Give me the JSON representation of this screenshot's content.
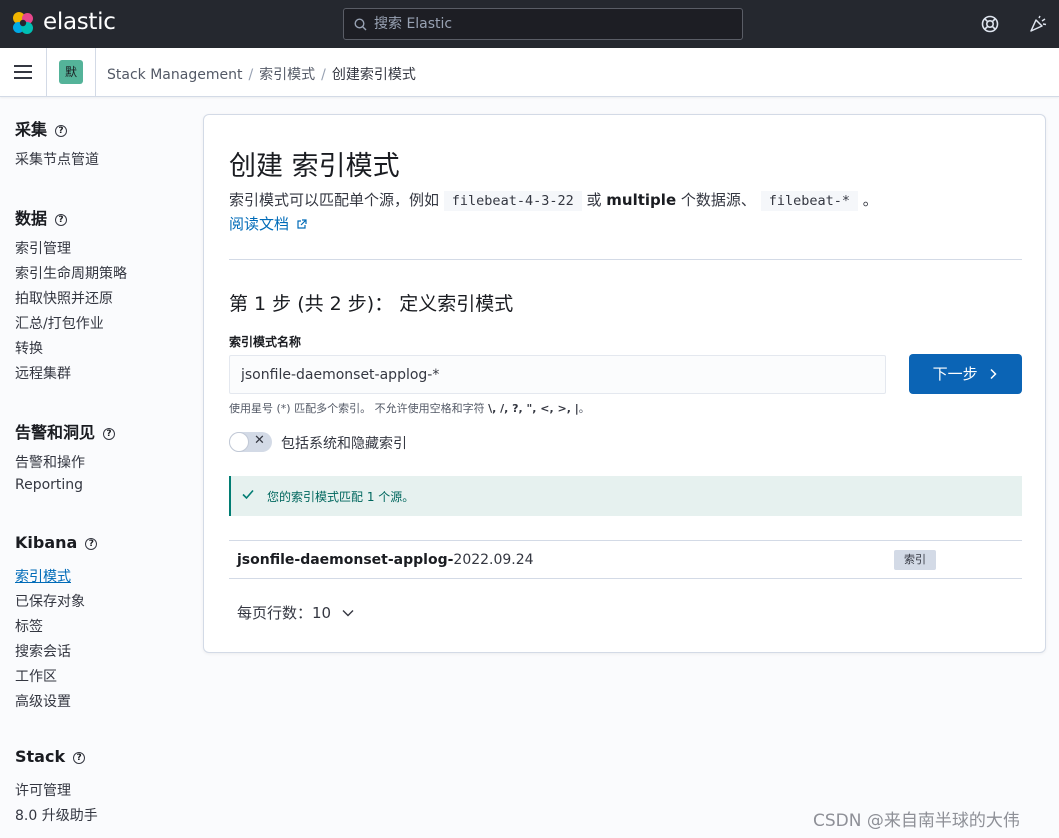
{
  "header": {
    "logo_text": "elastic",
    "search_placeholder": "搜索 Elastic"
  },
  "breadcrumb": {
    "space_badge": "默",
    "items": [
      "Stack Management",
      "索引模式",
      "创建索引模式"
    ]
  },
  "sidebar": {
    "sections": [
      {
        "title": "采集",
        "items": [
          "采集节点管道"
        ]
      },
      {
        "title": "数据",
        "items": [
          "索引管理",
          "索引生命周期策略",
          "拍取快照并还原",
          "汇总/打包作业",
          "转换",
          "远程集群"
        ]
      },
      {
        "title": "告警和洞见",
        "items": [
          "告警和操作",
          "Reporting"
        ]
      },
      {
        "title": "Kibana",
        "items": [
          "索引模式",
          "已保存对象",
          "标签",
          "搜索会话",
          "工作区",
          "高级设置"
        ]
      },
      {
        "title": "Stack",
        "items": [
          "许可管理",
          "8.0 升级助手"
        ]
      }
    ],
    "help_glyph": "?"
  },
  "main": {
    "title": "创建 索引模式",
    "desc_prefix": "索引模式可以匹配单个源，例如",
    "desc_code1": "filebeat-4-3-22",
    "desc_or": "或",
    "desc_multiple": "multiple",
    "desc_mid": "个数据源、",
    "desc_code2": "filebeat-*",
    "desc_end": "。",
    "doc_link": "阅读文档",
    "step_title": "第 1 步 (共 2 步)： 定义索引模式",
    "field_label": "索引模式名称",
    "field_value": "jsonfile-daemonset-applog-*",
    "next_button": "下一步",
    "help_prefix": "使用星号 (*) 匹配多个索引。 不允许使用空格和字符",
    "help_chars": "\\, /, ?, \", <, >, |",
    "help_end": "。",
    "toggle_label": "包括系统和隐藏索引",
    "toggle_on": false,
    "callout_text": "您的索引模式匹配 1 个源。",
    "result_name_bold": "jsonfile-daemonset-applog-",
    "result_name_rest": "2022.09.24",
    "result_tag": "索引",
    "rows_per_page": "每页行数：10"
  },
  "watermark": "CSDN @来自南半球的大伟",
  "colors": {
    "header_bg": "#25282f",
    "primary": "#0b64b5",
    "link": "#006bb8",
    "success_bg": "#e6f1ef",
    "success_text": "#00675e"
  }
}
